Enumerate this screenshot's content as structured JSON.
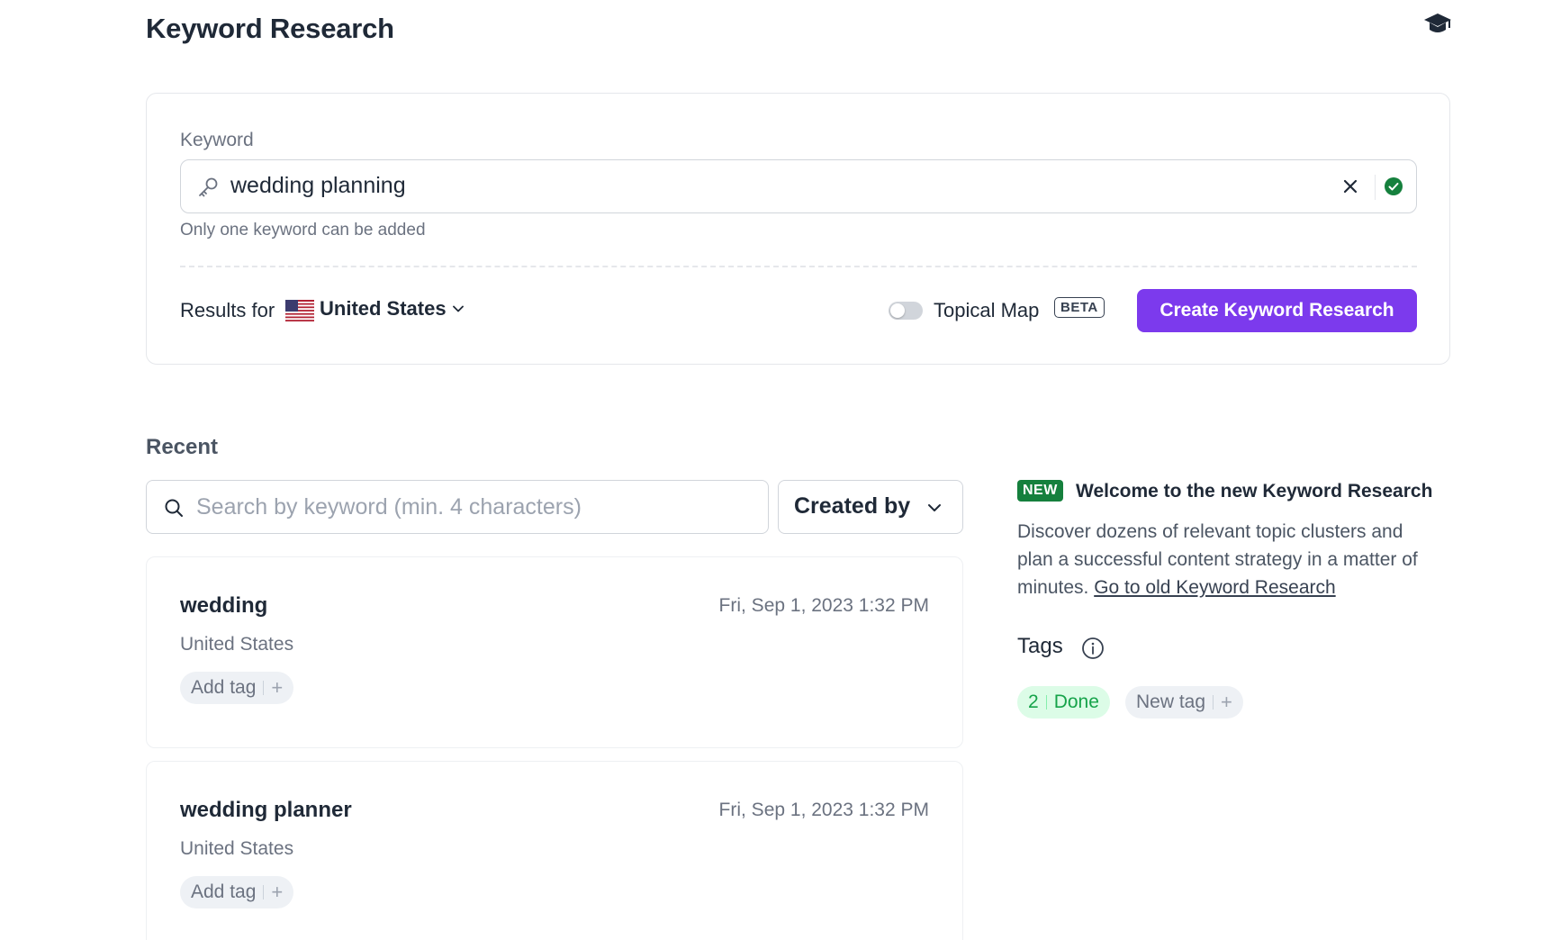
{
  "header": {
    "title": "Keyword Research",
    "academy_icon": "graduation-cap-icon"
  },
  "search_card": {
    "field_label": "Keyword",
    "keyword_value": "wedding planning",
    "hint": "Only one keyword can be added",
    "results_for_label": "Results for",
    "country": "United States",
    "topical_map_label": "Topical Map",
    "topical_map_enabled": false,
    "beta_label": "BETA",
    "create_button_label": "Create Keyword Research"
  },
  "recent": {
    "title": "Recent",
    "search_placeholder": "Search by keyword (min. 4 characters)",
    "created_by_label": "Created by",
    "items": [
      {
        "title": "wedding",
        "date": "Fri, Sep 1, 2023 1:32 PM",
        "country": "United States",
        "add_tag_label": "Add tag"
      },
      {
        "title": "wedding planner",
        "date": "Fri, Sep 1, 2023 1:32 PM",
        "country": "United States",
        "add_tag_label": "Add tag"
      }
    ]
  },
  "sidebar": {
    "new_badge": "NEW",
    "welcome_title": "Welcome to the new Keyword Research",
    "welcome_text": "Discover dozens of relevant topic clusters and plan a successful content strategy in a matter of minutes. ",
    "old_link": "Go to old Keyword Research",
    "tags_title": "Tags",
    "tags": [
      {
        "count": "2",
        "label": "Done"
      }
    ],
    "new_tag_label": "New tag"
  },
  "colors": {
    "primary": "#7c3aed",
    "success": "#15803d",
    "tag_done_bg": "#dcfce7"
  }
}
